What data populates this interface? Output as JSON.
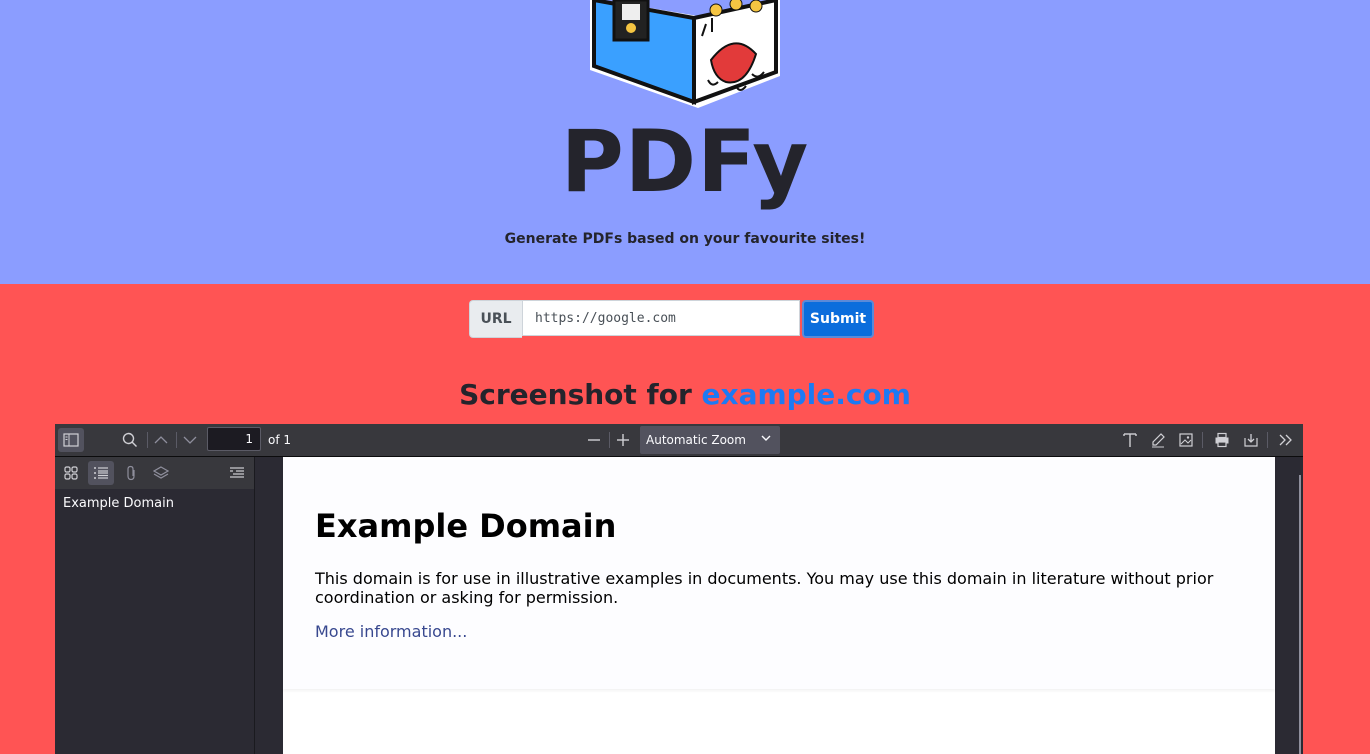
{
  "hero": {
    "title": "PDFy",
    "tagline": "Generate PDFs based on your favourite sites!"
  },
  "form": {
    "url_label": "URL",
    "url_value": "https://google.com",
    "submit_label": "Submit"
  },
  "screenshot": {
    "prefix": "Screenshot for",
    "domain": "example.com"
  },
  "pdf_viewer": {
    "page_number": "1",
    "page_count_label": "of 1",
    "zoom": "Automatic Zoom",
    "outline": [
      "Example Domain"
    ]
  },
  "document": {
    "heading": "Example Domain",
    "paragraph": "This domain is for use in illustrative examples in documents. You may use this domain in literature without prior coordination or asking for permission.",
    "link": "More information..."
  },
  "colors": {
    "hero_bg": "#8b9dff",
    "body_bg": "#ff5454",
    "submit_bg": "#0b6ddc",
    "link": "#1d7af3"
  }
}
